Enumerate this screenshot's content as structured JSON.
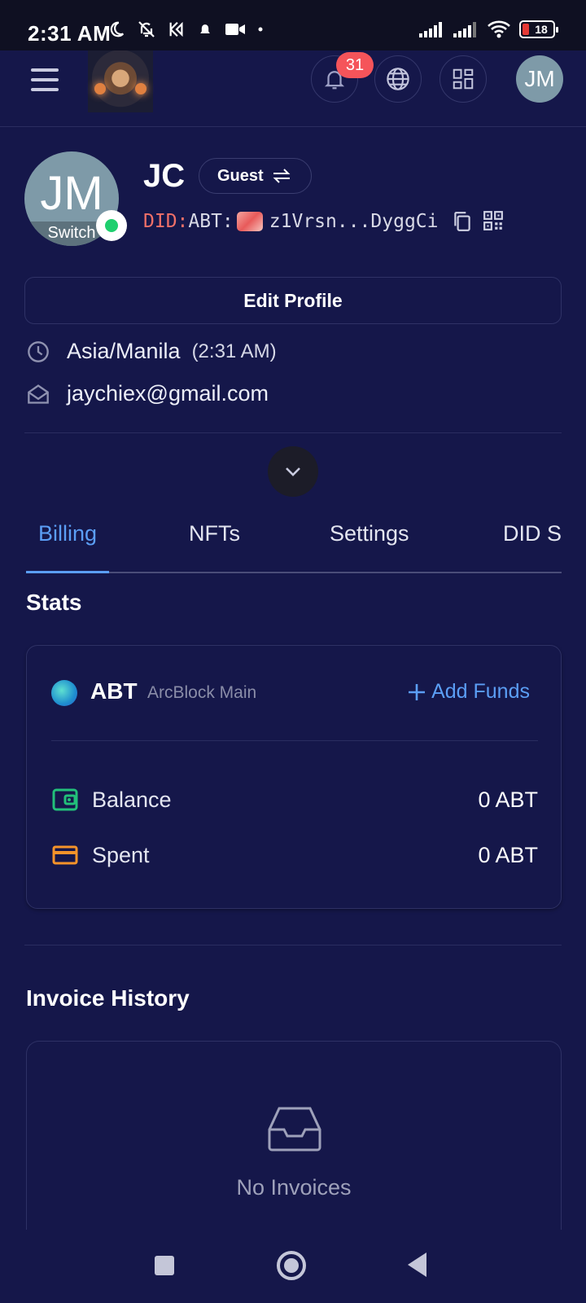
{
  "status_bar": {
    "time": "2:31 AM",
    "battery": "18",
    "icons": [
      "moon-icon",
      "bell-off-icon",
      "k-app-icon",
      "bell-icon",
      "video-icon",
      "dot-icon",
      "signal-icon",
      "signal-icon",
      "wifi-icon",
      "battery-icon"
    ]
  },
  "header": {
    "notification_count": "31",
    "avatar_initials": "JM",
    "icons": [
      "menu-icon",
      "bell-icon",
      "globe-icon",
      "grid-icon"
    ]
  },
  "profile": {
    "avatar_initials": "JM",
    "switch_label": "Switch",
    "name": "JC",
    "role_chip": "Guest",
    "did_prefix": "DID:",
    "did_type": "ABT:",
    "did_value": "z1Vrsn...DyggCi",
    "edit_button": "Edit Profile",
    "timezone": "Asia/Manila",
    "local_time": "(2:31 AM)",
    "email": "jaychiex@gmail.com"
  },
  "tabs": [
    {
      "label": "Billing",
      "active": true
    },
    {
      "label": "NFTs",
      "active": false
    },
    {
      "label": "Settings",
      "active": false
    },
    {
      "label": "DID S",
      "active": false
    }
  ],
  "stats": {
    "title": "Stats",
    "token": "ABT",
    "network": "ArcBlock Main",
    "add_funds": "Add Funds",
    "rows": [
      {
        "label": "Balance",
        "value": "0 ABT",
        "icon": "wallet-icon",
        "color": "#22c07a"
      },
      {
        "label": "Spent",
        "value": "0 ABT",
        "icon": "credit-card-icon",
        "color": "#f5932a"
      }
    ]
  },
  "invoices": {
    "title": "Invoice History",
    "empty_text": "No Invoices"
  },
  "colors": {
    "background": "#15174a",
    "accent": "#5b9ef5",
    "badge": "#f5545a",
    "online": "#1fcf6e"
  }
}
